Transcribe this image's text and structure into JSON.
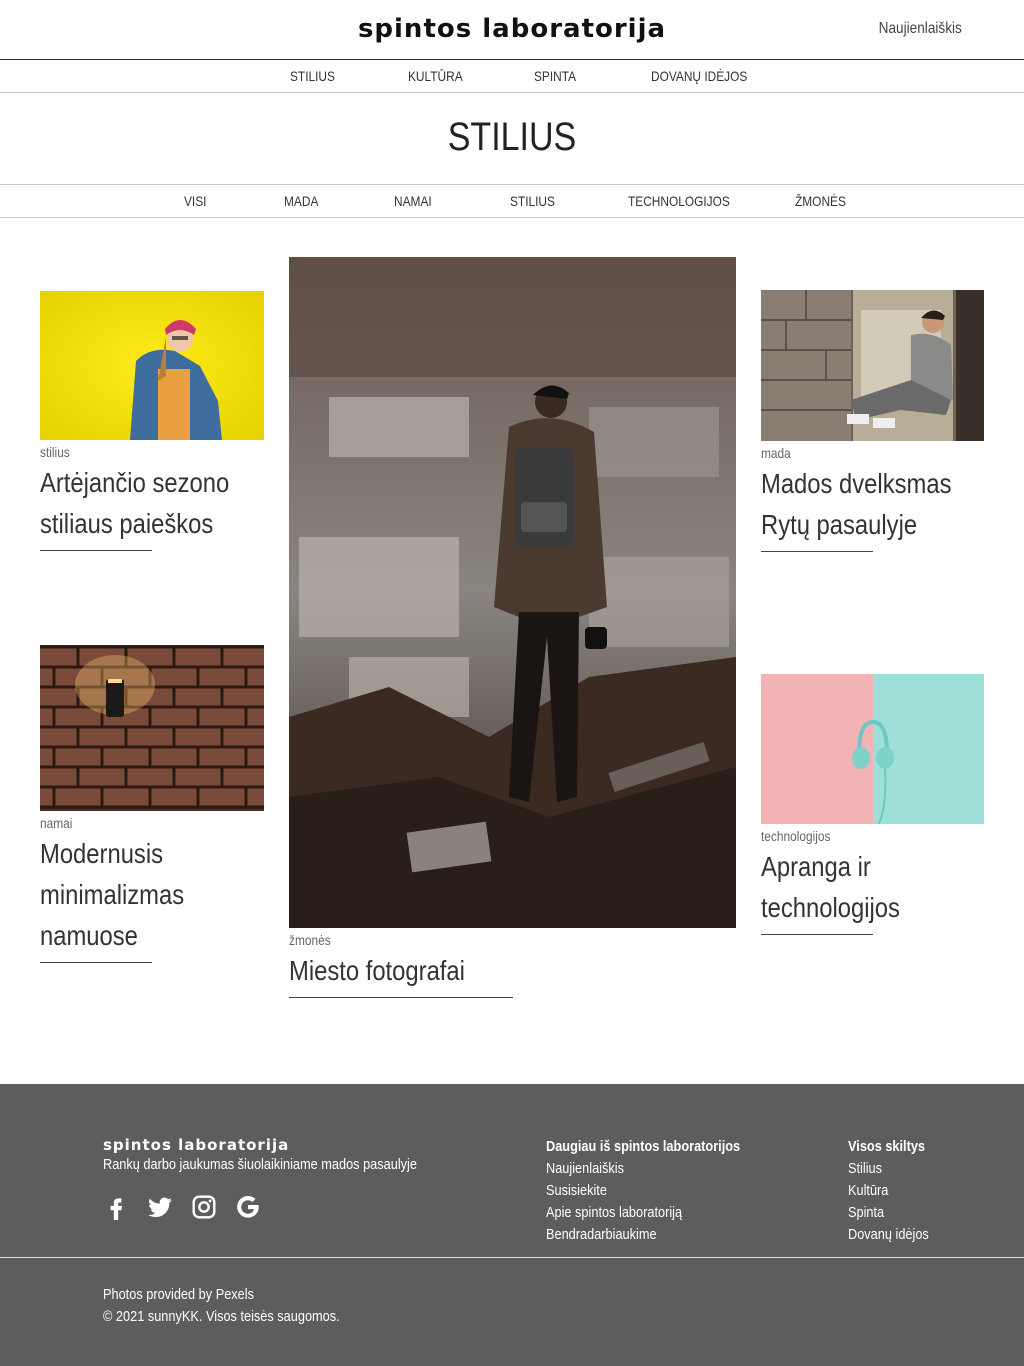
{
  "header": {
    "logo": "spintos laboratorija",
    "newsletter": "Naujienlaiškis"
  },
  "main_nav": [
    "STILIUS",
    "KULTŪRA",
    "SPINTA",
    "DOVANŲ IDĖJOS"
  ],
  "page_title": "STILIUS",
  "sub_nav": [
    "VISI",
    "MADA",
    "NAMAI",
    "STILIUS",
    "TECHNOLOGIJOS",
    "ŽMONĖS"
  ],
  "articles": [
    {
      "category": "stilius",
      "title": "Artėjančio sezono stiliaus paieškos",
      "image": "woman-yellow-wall"
    },
    {
      "category": "namai",
      "title": "Modernusis minimalizmas namuose",
      "image": "brick-wall-lamp"
    },
    {
      "category": "žmonės",
      "title": "Miesto fotografai",
      "image": "photographer-city"
    },
    {
      "category": "mada",
      "title": "Mados dvelksmas Rytų pasaulyje",
      "image": "man-sitting-window"
    },
    {
      "category": "technologijos",
      "title": "Apranga ir technologijos",
      "image": "headphones-pastel"
    }
  ],
  "footer": {
    "logo": "spintos laboratorija",
    "tagline": "Rankų darbo jaukumas šiuolaikiniame mados pasaulyje",
    "social": [
      "facebook-icon",
      "twitter-icon",
      "instagram-icon",
      "google-icon"
    ],
    "more": {
      "heading": "Daugiau iš spintos laboratorijos",
      "links": [
        "Naujienlaiškis",
        "Susisiekite",
        "Apie spintos laboratoriją",
        "Bendradarbiaukime"
      ]
    },
    "sections": {
      "heading": "Visos skiltys",
      "links": [
        "Stilius",
        "Kultūra",
        "Spinta",
        "Dovanų idėjos"
      ]
    },
    "credit": "Photos provided by Pexels",
    "copyright": "© 2021 sunnyKK. Visos teisės saugomos."
  },
  "colors": {
    "footer_bg": "#5e5d5d",
    "accent": "#222222"
  }
}
